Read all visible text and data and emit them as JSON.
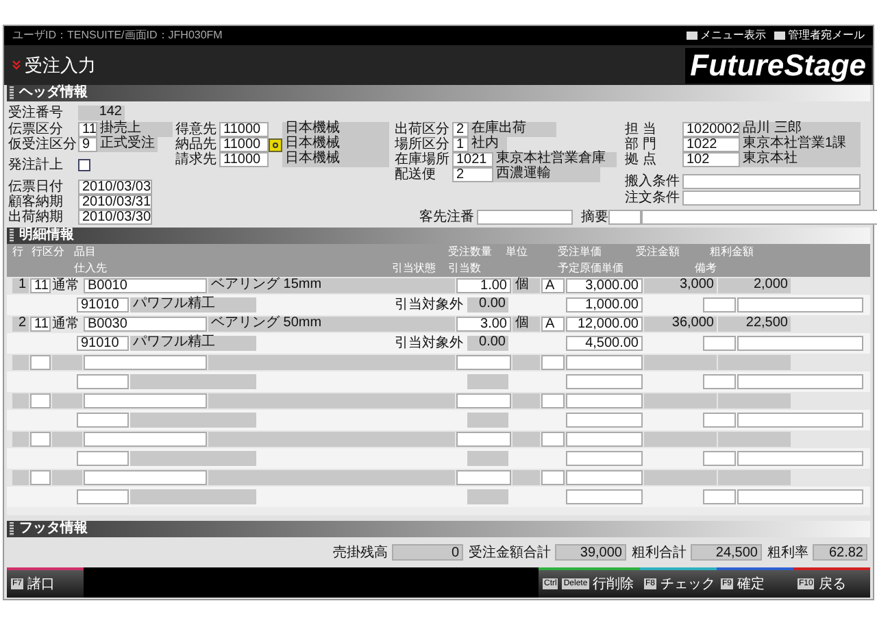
{
  "top_bar": {
    "user_info": "ユーザID：TENSUITE/画面ID：JFH030FM",
    "links": [
      "メニュー表示",
      "管理者宛メール"
    ]
  },
  "title": "受注入力",
  "logo": "FutureStage",
  "header": {
    "title": "ヘッダ情報",
    "order_no": {
      "label": "受注番号",
      "value": "142"
    },
    "col1": [
      {
        "label": "伝票区分",
        "code": "11",
        "name": "掛売上"
      },
      {
        "label": "仮受注区分",
        "code": "9",
        "name": "正式受注"
      }
    ],
    "purchase_post": {
      "label": "発注計上",
      "checked": false
    },
    "dates": [
      {
        "label": "伝票日付",
        "value": "2010/03/03"
      },
      {
        "label": "顧客納期",
        "value": "2010/03/31"
      },
      {
        "label": "出荷納期",
        "value": "2010/03/30"
      }
    ],
    "col2": [
      {
        "label": "得意先",
        "code": "11000",
        "name": "日本機械"
      },
      {
        "label": "納品先",
        "code": "11000",
        "name": "日本機械"
      },
      {
        "label": "請求先",
        "code": "11000",
        "name": "日本機械"
      }
    ],
    "col3": [
      {
        "label": "出荷区分",
        "code": "2",
        "name": "在庫出荷"
      },
      {
        "label": "場所区分",
        "code": "1",
        "name": "社内"
      },
      {
        "label": "在庫場所",
        "code": "1021",
        "name": "東京本社営業倉庫"
      },
      {
        "label": "配送便",
        "code": "2",
        "name": "西濃運輸"
      }
    ],
    "col4": [
      {
        "label": "担 当",
        "code": "1020002",
        "name": "品川 三郎"
      },
      {
        "label": "部 門",
        "code": "1022",
        "name": "東京本社営業1課"
      },
      {
        "label": "拠 点",
        "code": "102",
        "name": "東京本社"
      }
    ],
    "conditions": [
      {
        "label": "搬入条件"
      },
      {
        "label": "注文条件"
      }
    ],
    "customer_order_no": {
      "label": "客先注番"
    },
    "summary": {
      "label": "摘要"
    }
  },
  "detail": {
    "title": "明細情報",
    "columns_top": [
      "行",
      "行区分",
      "品目",
      "受注数量",
      "単位",
      "受注単価",
      "受注金額",
      "粗利金額"
    ],
    "columns_bottom": [
      "仕入先",
      "引当状態",
      "引当数",
      "予定原価単価",
      "備考"
    ],
    "rows": [
      {
        "no": "1",
        "type_code": "11",
        "type": "通常",
        "item_code": "B0010",
        "item_name": "ベアリング 15mm",
        "qty": "1.00",
        "unit": "個",
        "tax": "A",
        "price": "3,000.00",
        "amount": "3,000",
        "profit": "2,000",
        "supplier_code": "91010",
        "supplier_name": "パワフル精工",
        "alloc_status": "引当対象外",
        "alloc_qty": "0.00",
        "cost": "1,000.00"
      },
      {
        "no": "2",
        "type_code": "11",
        "type": "通常",
        "item_code": "B0030",
        "item_name": "ベアリング 50mm",
        "qty": "3.00",
        "unit": "個",
        "tax": "A",
        "price": "12,000.00",
        "amount": "36,000",
        "profit": "22,500",
        "supplier_code": "91010",
        "supplier_name": "パワフル精工",
        "alloc_status": "引当対象外",
        "alloc_qty": "0.00",
        "cost": "4,500.00"
      }
    ]
  },
  "footer": {
    "title": "フッタ情報",
    "totals": [
      {
        "label": "売掛残高",
        "value": "0"
      },
      {
        "label": "受注金額合計",
        "value": "39,000"
      },
      {
        "label": "粗利合計",
        "value": "24,500"
      },
      {
        "label": "粗利率",
        "value": "62.82"
      }
    ]
  },
  "function_keys": [
    {
      "keys": [
        "F7"
      ],
      "label": "諸口",
      "color": "#d0306a"
    },
    {
      "keys": [
        "Ctrl",
        "Delete"
      ],
      "label": "行削除",
      "color": "#30b040"
    },
    {
      "keys": [
        "F8"
      ],
      "label": "チェック",
      "color": "#30b0c0"
    },
    {
      "keys": [
        "F9"
      ],
      "label": "確定",
      "color": "#3060d0"
    },
    {
      "keys": [
        "F10"
      ],
      "label": "戻る",
      "color": "#d02020"
    }
  ]
}
